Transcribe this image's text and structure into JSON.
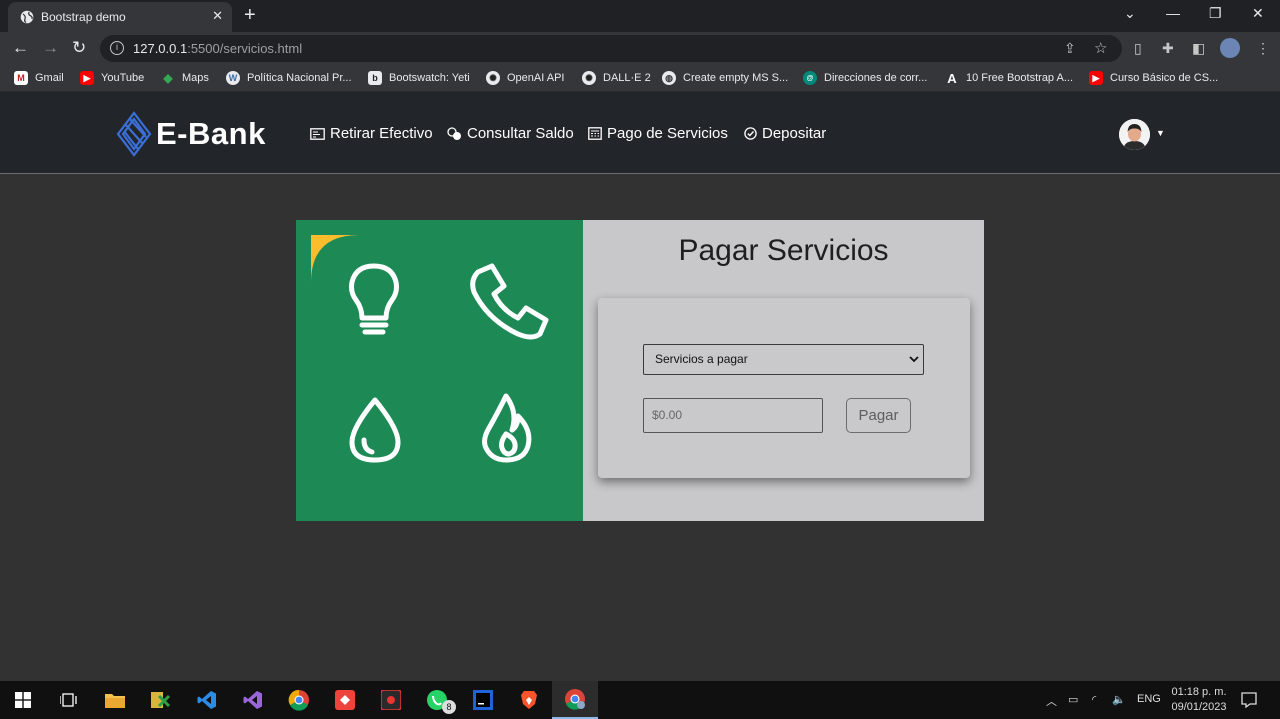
{
  "browser": {
    "tab_title": "Bootstrap demo",
    "new_tab": "+",
    "url_host": "127.0.0.1",
    "url_rest": ":5500/servicios.html",
    "bookmarks": [
      {
        "label": "Gmail",
        "icon": "gmail-icon",
        "color": "#c5221f"
      },
      {
        "label": "YouTube",
        "icon": "youtube-icon",
        "color": "#ff0000"
      },
      {
        "label": "Maps",
        "icon": "maps-icon",
        "color": "#34a853"
      },
      {
        "label": "Política Nacional Pr...",
        "icon": "wordpress-icon",
        "color": "#3b6ea5"
      },
      {
        "label": "Bootswatch: Yeti",
        "icon": "bootswatch-icon",
        "color": "#222222"
      },
      {
        "label": "OpenAI API",
        "icon": "openai-icon",
        "color": "#444444"
      },
      {
        "label": "DALL·E 2",
        "icon": "openai-icon",
        "color": "#444444"
      },
      {
        "label": "Create empty MS S...",
        "icon": "globe-icon",
        "color": "#555555"
      },
      {
        "label": "Direcciones de corr...",
        "icon": "globe-icon",
        "color": "#00897b"
      },
      {
        "label": "10 Free Bootstrap A...",
        "icon": "ai-logo-icon",
        "color": "#333333"
      },
      {
        "label": "Curso Básico de CS...",
        "icon": "youtube-icon",
        "color": "#ff0000"
      }
    ]
  },
  "site": {
    "brand": "E-Bank",
    "nav": [
      {
        "label": "Retirar Efectivo",
        "icon": "cash-icon"
      },
      {
        "label": "Consultar Saldo",
        "icon": "coins-icon"
      },
      {
        "label": "Pago de Servicios",
        "icon": "calculator-icon"
      },
      {
        "label": "Depositar",
        "icon": "check-circle-icon"
      }
    ],
    "accent": "#1d8a56"
  },
  "payment": {
    "title": "Pagar Servicios",
    "select_value": "Servicios a pagar",
    "amount_placeholder": "$0.00",
    "pay_label": "Pagar",
    "tiles": [
      {
        "icon": "lightbulb-icon",
        "color": "#fbbd2c"
      },
      {
        "icon": "phone-icon",
        "color": "#0a6fc2"
      },
      {
        "icon": "water-drop-icon",
        "color": "#4fb9ea"
      },
      {
        "icon": "flame-icon",
        "color": "#c91a62"
      }
    ]
  },
  "taskbar": {
    "whatsapp_badge": "8",
    "language": "ENG",
    "time": "01:18 p. m.",
    "date": "09/01/2023"
  }
}
